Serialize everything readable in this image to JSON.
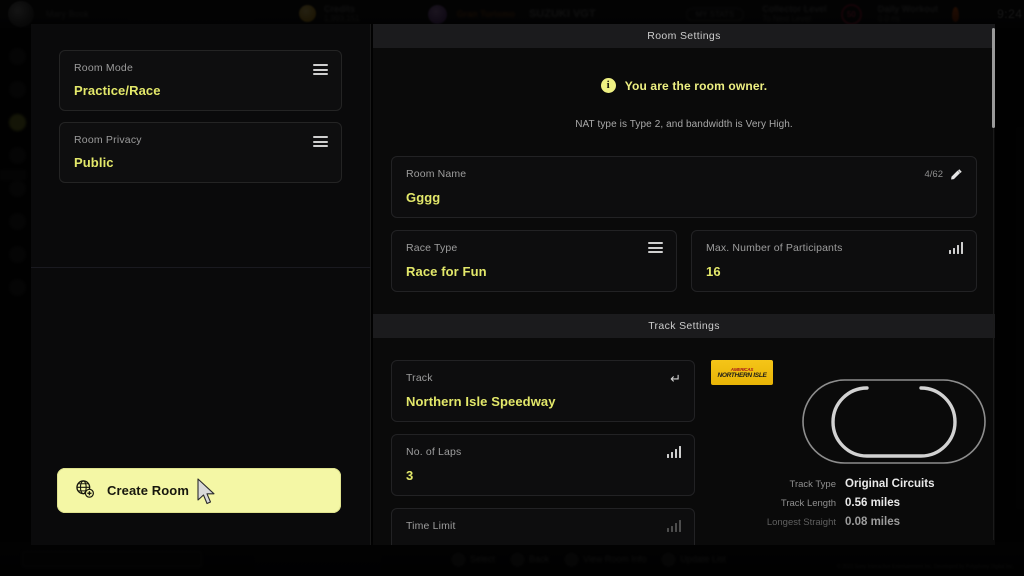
{
  "background": {
    "topbar": {
      "profile_name": "Mary Book",
      "credits_label": "Credits",
      "credits_value": "1,993,151",
      "brand_text": "SUZUKI VGT",
      "orange_text": "Gran Turismo",
      "pill_text": "MY STATS",
      "collector_label": "Collector Level",
      "collector_sub": "To Next Level",
      "collector_value": "50",
      "workout_label": "Daily Workout",
      "workout_sub": "0.0 mi",
      "time": "9:24"
    },
    "bottombar": {
      "search_placeholder": "",
      "hints": [
        {
          "label": "Select"
        },
        {
          "label": "Back"
        },
        {
          "label": "View Room Info"
        },
        {
          "label": "Update List"
        }
      ],
      "copyright": "© 2022 Sony Interactive Entertainment Inc. Developed by Polyphony Digital Inc."
    }
  },
  "left_panel": {
    "options": [
      {
        "label": "Room Mode",
        "value": "Practice/Race",
        "icon": "list-icon"
      },
      {
        "label": "Room Privacy",
        "value": "Public",
        "icon": "list-icon"
      }
    ],
    "create_button": {
      "label": "Create Room",
      "icon": "globe-plus-icon"
    }
  },
  "right_panel": {
    "room_settings": {
      "header": "Room Settings",
      "owner_notice": "You are the room owner.",
      "owner_icon": "info-icon",
      "nat_line": "NAT type is Type 2, and bandwidth is Very High.",
      "room_name": {
        "label": "Room Name",
        "value": "Gggg",
        "counter": "4/62",
        "icon": "pencil-icon"
      },
      "race_type": {
        "label": "Race Type",
        "value": "Race for Fun",
        "icon": "list-icon"
      },
      "max_participants": {
        "label": "Max. Number of Participants",
        "value": "16",
        "icon": "bars-icon"
      }
    },
    "track_settings": {
      "header": "Track Settings",
      "track": {
        "label": "Track",
        "value": "Northern Isle Speedway",
        "icon": "enter-icon"
      },
      "laps": {
        "label": "No. of Laps",
        "value": "3",
        "icon": "bars-icon"
      },
      "time_limit": {
        "label": "Time Limit",
        "value": "",
        "icon": "bars-icon"
      },
      "badge": {
        "line1": "AMERICAS",
        "line2": "NORTHERN ISLE"
      },
      "stats": [
        {
          "key": "Track Type",
          "value": "Original Circuits"
        },
        {
          "key": "Track Length",
          "value": "0.56 miles"
        },
        {
          "key": "Longest Straight",
          "value": "0.08 miles"
        }
      ],
      "scroll_indicator": "⌄"
    }
  },
  "colors": {
    "accent_yellow": "#e3e86a",
    "button_yellow": "#f4f7a5",
    "badge_yellow": "#f5c518",
    "panel_bg": "#0a0a0b",
    "card_bg": "#0d0d0e",
    "header_bg": "#1b1b1d"
  }
}
